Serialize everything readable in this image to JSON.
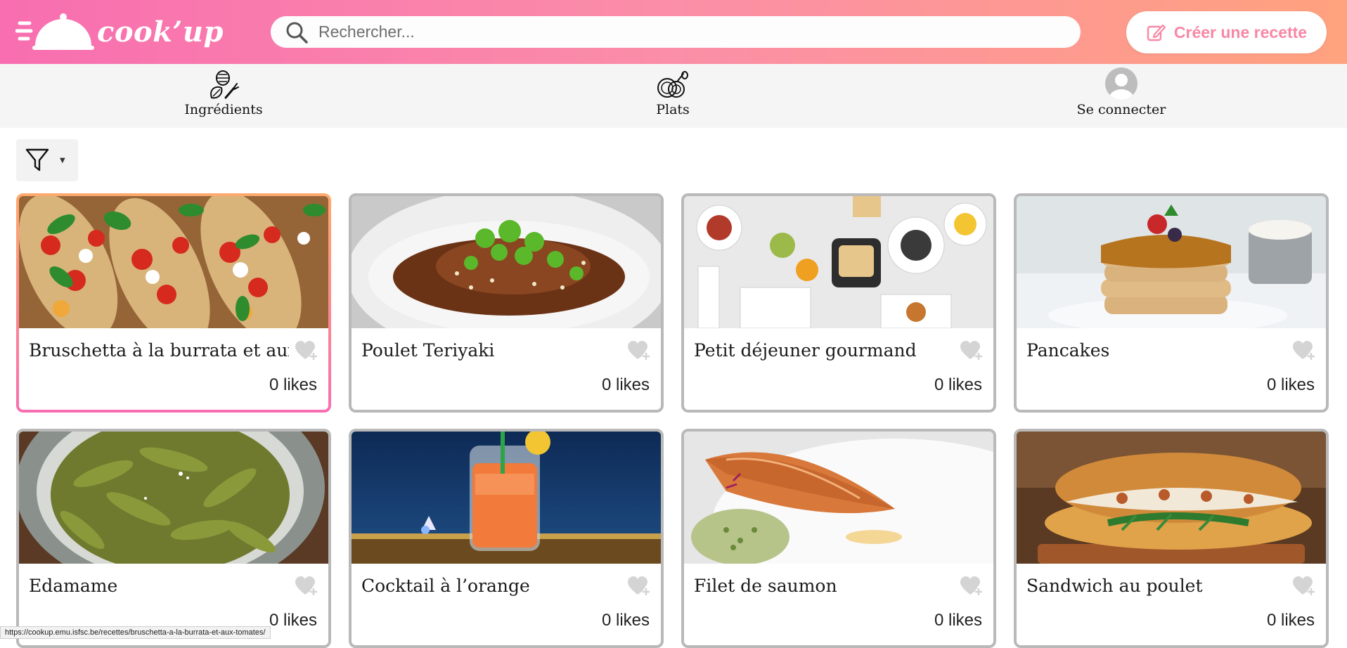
{
  "brand": {
    "name": "cook’up"
  },
  "search": {
    "placeholder": "Rechercher..."
  },
  "header": {
    "create_label": "Créer une recette"
  },
  "nav": {
    "ingredients": "Ingrédients",
    "plats": "Plats",
    "login": "Se connecter"
  },
  "recipes": [
    {
      "title": "Bruschetta à la burrata et aux tomates",
      "likes": "0 likes"
    },
    {
      "title": "Poulet Teriyaki",
      "likes": "0 likes"
    },
    {
      "title": "Petit déjeuner gourmand",
      "likes": "0 likes"
    },
    {
      "title": "Pancakes",
      "likes": "0 likes"
    },
    {
      "title": "Edamame",
      "likes": "0 likes"
    },
    {
      "title": "Cocktail à l’orange",
      "likes": "0 likes"
    },
    {
      "title": "Filet de saumon",
      "likes": "0 likes"
    },
    {
      "title": "Sandwich au poulet",
      "likes": "0 likes"
    }
  ],
  "status_url": "https://cookup.emu.isfsc.be/recettes/bruschetta-a-la-burrata-et-aux-tomates/",
  "colors": {
    "gradient_start": "#f86eb0",
    "gradient_end": "#ffa27e",
    "accent": "#f887a6"
  }
}
